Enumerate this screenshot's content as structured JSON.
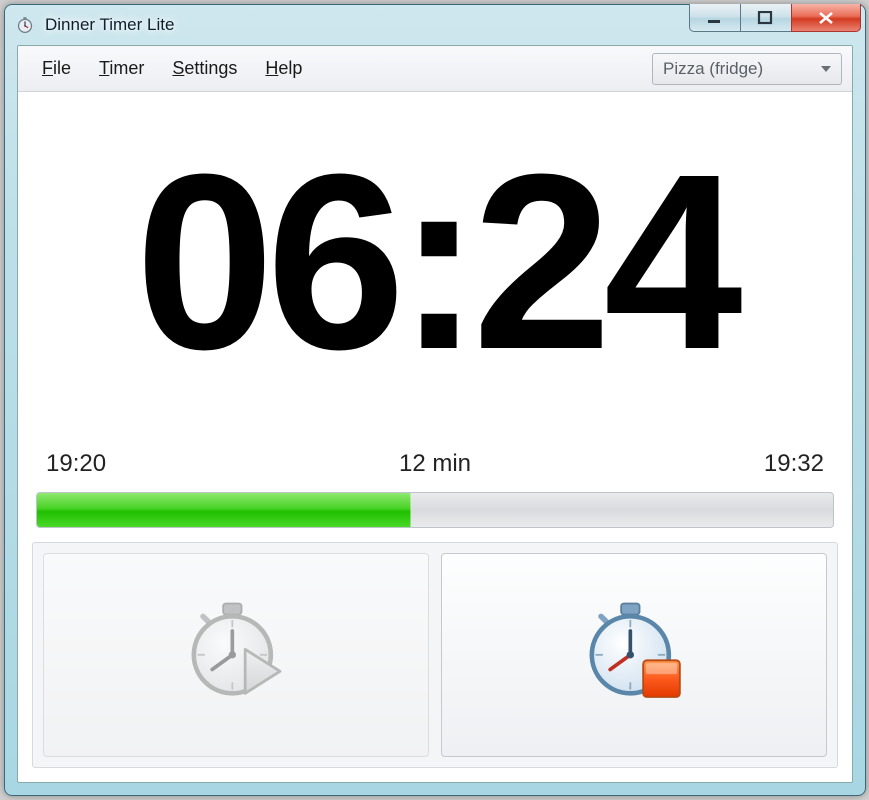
{
  "window": {
    "title": "Dinner Timer Lite"
  },
  "menubar": {
    "file": "File",
    "timer": "Timer",
    "settings": "Settings",
    "help": "Help"
  },
  "preset": {
    "selected": "Pizza (fridge)"
  },
  "countdown": {
    "display": "06:24"
  },
  "times": {
    "start": "19:20",
    "duration": "12 min",
    "end": "19:32"
  },
  "progress": {
    "percent": 47
  },
  "buttons": {
    "start_enabled": false,
    "stop_enabled": true
  }
}
